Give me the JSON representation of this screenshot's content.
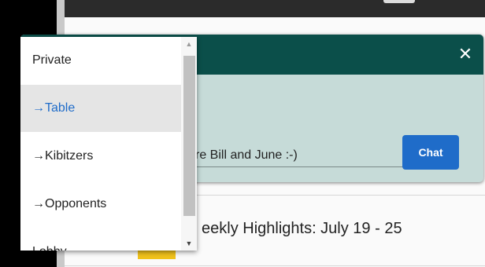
{
  "dialog": {
    "close_glyph": "✕",
    "message_value": "re Bill and June :-)",
    "chat_label": "Chat"
  },
  "background": {
    "headline": "eekly Highlights: July 19 - 25"
  },
  "dropdown": {
    "options": [
      {
        "label": "Private",
        "selected": false
      },
      {
        "label": "→Table",
        "selected": true
      },
      {
        "label": "→Kibitzers",
        "selected": false
      },
      {
        "label": "→Opponents",
        "selected": false
      },
      {
        "label": "Lobby",
        "selected": false
      }
    ],
    "scroll_up_glyph": "▲",
    "scroll_down_glyph": "▼"
  },
  "colors": {
    "dialog_header": "#0b4f4a",
    "dialog_body": "#c6dbd8",
    "accent_blue": "#1f6cc9",
    "selected_bg": "#e5e5e5"
  }
}
